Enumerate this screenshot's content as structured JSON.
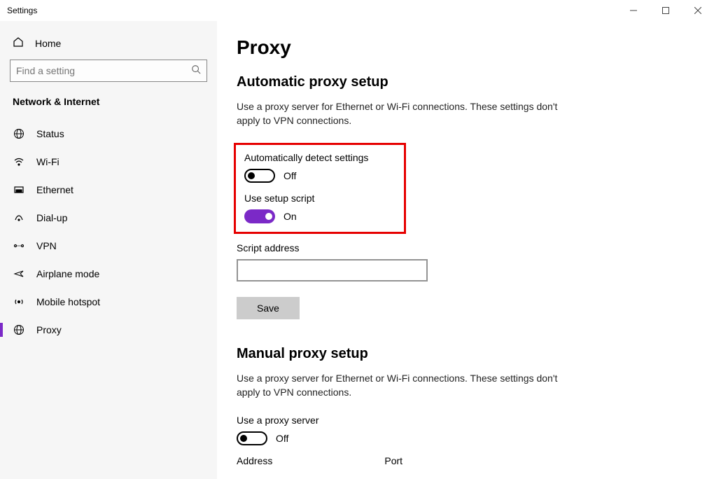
{
  "window": {
    "title": "Settings"
  },
  "sidebar": {
    "home": "Home",
    "search_placeholder": "Find a setting",
    "section": "Network & Internet",
    "items": [
      {
        "label": "Status"
      },
      {
        "label": "Wi-Fi"
      },
      {
        "label": "Ethernet"
      },
      {
        "label": "Dial-up"
      },
      {
        "label": "VPN"
      },
      {
        "label": "Airplane mode"
      },
      {
        "label": "Mobile hotspot"
      },
      {
        "label": "Proxy",
        "selected": true
      }
    ]
  },
  "main": {
    "title": "Proxy",
    "auto": {
      "heading": "Automatic proxy setup",
      "desc": "Use a proxy server for Ethernet or Wi-Fi connections. These settings don't apply to VPN connections.",
      "detect_label": "Automatically detect settings",
      "detect_state": "Off",
      "script_label": "Use setup script",
      "script_state": "On",
      "address_label": "Script address",
      "address_value": "",
      "save_label": "Save"
    },
    "manual": {
      "heading": "Manual proxy setup",
      "desc": "Use a proxy server for Ethernet or Wi-Fi connections. These settings don't apply to VPN connections.",
      "use_label": "Use a proxy server",
      "use_state": "Off",
      "address_label": "Address",
      "port_label": "Port"
    }
  }
}
